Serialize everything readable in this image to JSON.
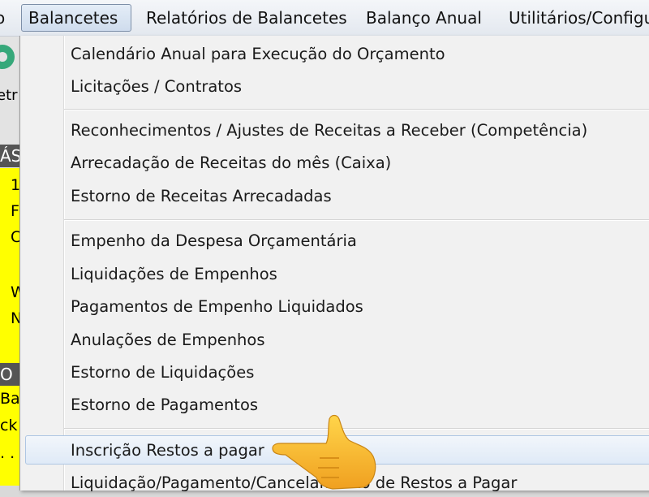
{
  "menubar": {
    "items": [
      {
        "label": "o"
      },
      {
        "label": "Balancetes"
      },
      {
        "label": "Relatórios de Balancetes"
      },
      {
        "label": "Balanço Anual"
      },
      {
        "label": "Utilitários/Configu"
      }
    ]
  },
  "left": {
    "toolbar_label": "etr",
    "section1_header": "ÁS",
    "section1_lines": [
      "1",
      "F",
      "C",
      "",
      "W",
      "N"
    ],
    "section2_header": "O",
    "section2_lines": [
      "Ba",
      "ck",
      ". ."
    ]
  },
  "dropdown": {
    "group1": [
      "Calendário Anual para Execução do Orçamento",
      "Licitações / Contratos"
    ],
    "group2": [
      "Reconhecimentos / Ajustes de Receitas a Receber (Competência)",
      "Arrecadação de Receitas do mês (Caixa)",
      "Estorno de Receitas Arrecadadas"
    ],
    "group3": [
      "Empenho da Despesa Orçamentária",
      "Liquidações de Empenhos",
      "Pagamentos de Empenho Liquidados",
      "Anulações de Empenhos",
      "Estorno de Liquidações",
      "Estorno de Pagamentos"
    ],
    "group4": [
      "Inscrição Restos a pagar",
      "Liquidação/Pagamento/Cancelamento de Restos a Pagar"
    ]
  },
  "colors": {
    "highlight": "#dfeaf7",
    "yellow": "#ffff00",
    "menu_bg": "#f1f1f1"
  }
}
